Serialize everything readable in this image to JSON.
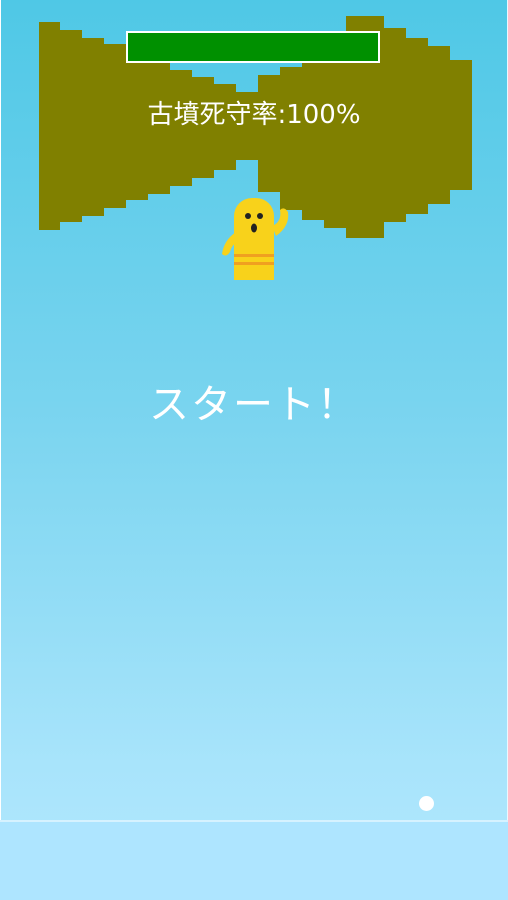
{
  "hud": {
    "defense_label": "古墳死守率:100%",
    "health_fraction": 1.0
  },
  "message": {
    "start": "スタート！"
  },
  "colors": {
    "sky_top": "#4fc8e6",
    "sky_bottom": "#b3e8ff",
    "kofun": "#808000",
    "health": "#009000",
    "character": "#f8d21b",
    "character_band": "#f0a020"
  },
  "objects": {
    "kofun": "keyhole-tomb",
    "player": "haniwa-character",
    "projectile": "ball"
  }
}
